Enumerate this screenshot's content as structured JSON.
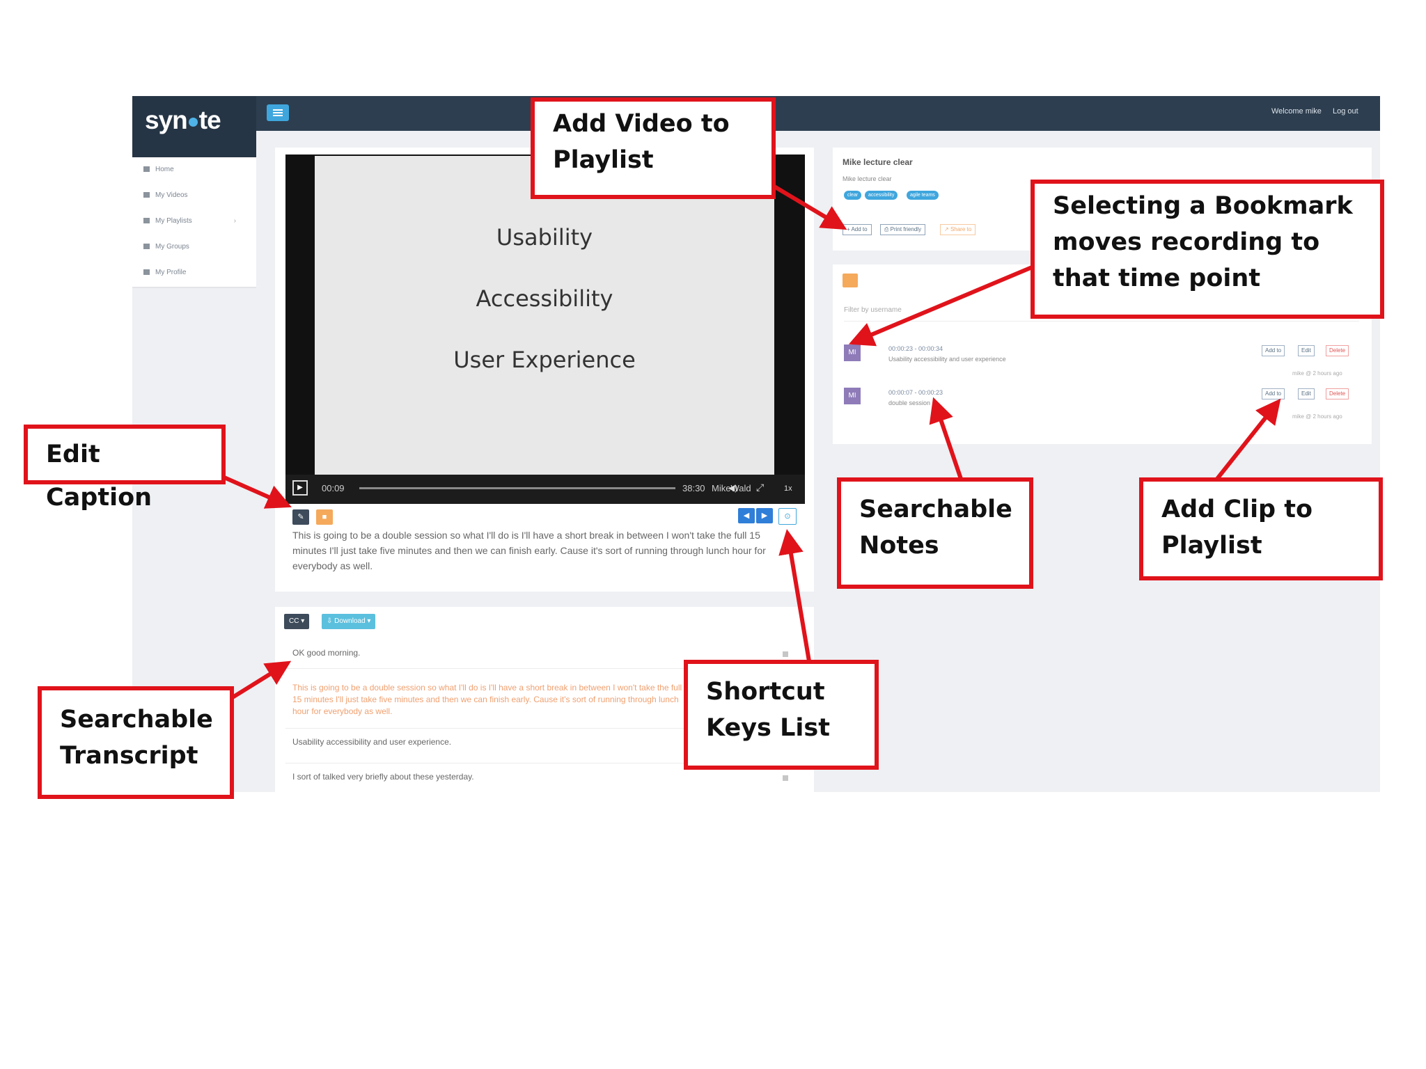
{
  "app": {
    "logo": "syn",
    "logo_tail": "te",
    "welcome": "Welcome mike",
    "logout": "Log out"
  },
  "sidebar": {
    "items": [
      {
        "label": "Home",
        "icon": "home-icon"
      },
      {
        "label": "My Videos",
        "icon": "video-icon"
      },
      {
        "label": "My Playlists",
        "icon": "list-icon"
      },
      {
        "label": "My Groups",
        "icon": "group-icon"
      },
      {
        "label": "My Profile",
        "icon": "user-icon"
      }
    ]
  },
  "video": {
    "slide_lines": [
      "Usability",
      "Accessibility",
      "User Experience"
    ],
    "current_time": "00:09",
    "total_time": "38:30",
    "name_tag": "MikeWald",
    "speed": "1x",
    "caption": "This is going to be a double session so what I'll do is I'll have a short break in between I won't take the full 15 minutes I'll just take five minutes and then we can finish early. Cause it's sort of running through lunch hour for everybody as well."
  },
  "transcript": {
    "cc_label": "CC",
    "download_label": "Download",
    "rows": [
      {
        "text": "OK good morning.",
        "active": false
      },
      {
        "text": "This is going to be a double session so what I'll do is I'll have a short break in between I won't take the full 15 minutes I'll just take five minutes and then we can finish early. Cause it's sort of running through lunch hour for everybody as well.",
        "active": true
      },
      {
        "text": "Usability accessibility and user experience.",
        "active": false
      },
      {
        "text": "I sort of talked very briefly about these yesterday.",
        "active": false
      }
    ]
  },
  "info": {
    "title": "Mike lecture clear",
    "description": "Mike lecture clear",
    "tags": [
      "clear",
      "accessibility",
      "agile teams"
    ],
    "buttons": [
      "Add to",
      "Print friendly",
      "Share to"
    ]
  },
  "notes": {
    "filter_placeholder": "Filter by username",
    "items": [
      {
        "avatar": "MI",
        "time": "00:00:23 - 00:00:34",
        "text": "Usability accessibility and user experience",
        "meta": "mike @ 2 hours ago"
      },
      {
        "avatar": "MI",
        "time": "00:00:07 - 00:00:23",
        "text": "double session",
        "meta": "mike @ 2 hours ago"
      }
    ],
    "buttons": {
      "add": "Add to",
      "edit": "Edit",
      "delete": "Delete"
    }
  },
  "callouts": {
    "add_video": "Add Video to Playlist",
    "bookmark": "Selecting a Bookmark moves recording to that time point",
    "edit_caption": "Edit Caption",
    "searchable_notes": "Searchable Notes",
    "add_clip": "Add Clip to Playlist",
    "searchable_transcript": "Searchable Transcript",
    "shortcut_keys": "Shortcut Keys List"
  },
  "colors": {
    "topbar": "#2d3e50",
    "accent_blue": "#3fa6dd",
    "accent_orange": "#f5a95b",
    "callout_red": "#e0131b"
  }
}
